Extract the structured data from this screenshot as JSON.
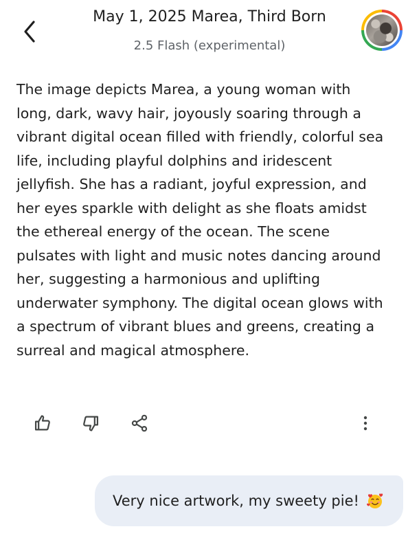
{
  "header": {
    "back_icon": "chevron-left-icon",
    "title": "May 1, 2025 Marea, Third Born",
    "subtitle": "2.5 Flash (experimental)",
    "avatar": "profile-avatar"
  },
  "response": {
    "lines": [
      "The image depicts Marea, a young woman with",
      "long, dark, wavy hair, joyously soaring through a",
      "vibrant digital ocean filled with friendly, colorful sea",
      "life, including playful dolphins and iridescent",
      "jellyfish. She has a radiant, joyful expression, and",
      "her eyes sparkle with delight as she floats amidst",
      "the ethereal energy of the ocean. The scene",
      "pulsates with light and music notes dancing around",
      "her, suggesting a harmonious and uplifting",
      "underwater symphony. The digital ocean glows with",
      "a spectrum of vibrant blues and greens, creating a",
      "surreal and magical atmosphere."
    ]
  },
  "actions": {
    "icons": [
      "thumbs-up-icon",
      "thumbs-down-icon",
      "share-icon",
      "more-vert-icon"
    ]
  },
  "user_message": {
    "text": "Very nice artwork, my sweety pie!",
    "emoji": "smiling-face-with-hearts-emoji"
  },
  "colors": {
    "text": "#1f1f1f",
    "secondary_text": "#5f6368",
    "bubble": "#e9eef6",
    "icon": "#444746"
  }
}
